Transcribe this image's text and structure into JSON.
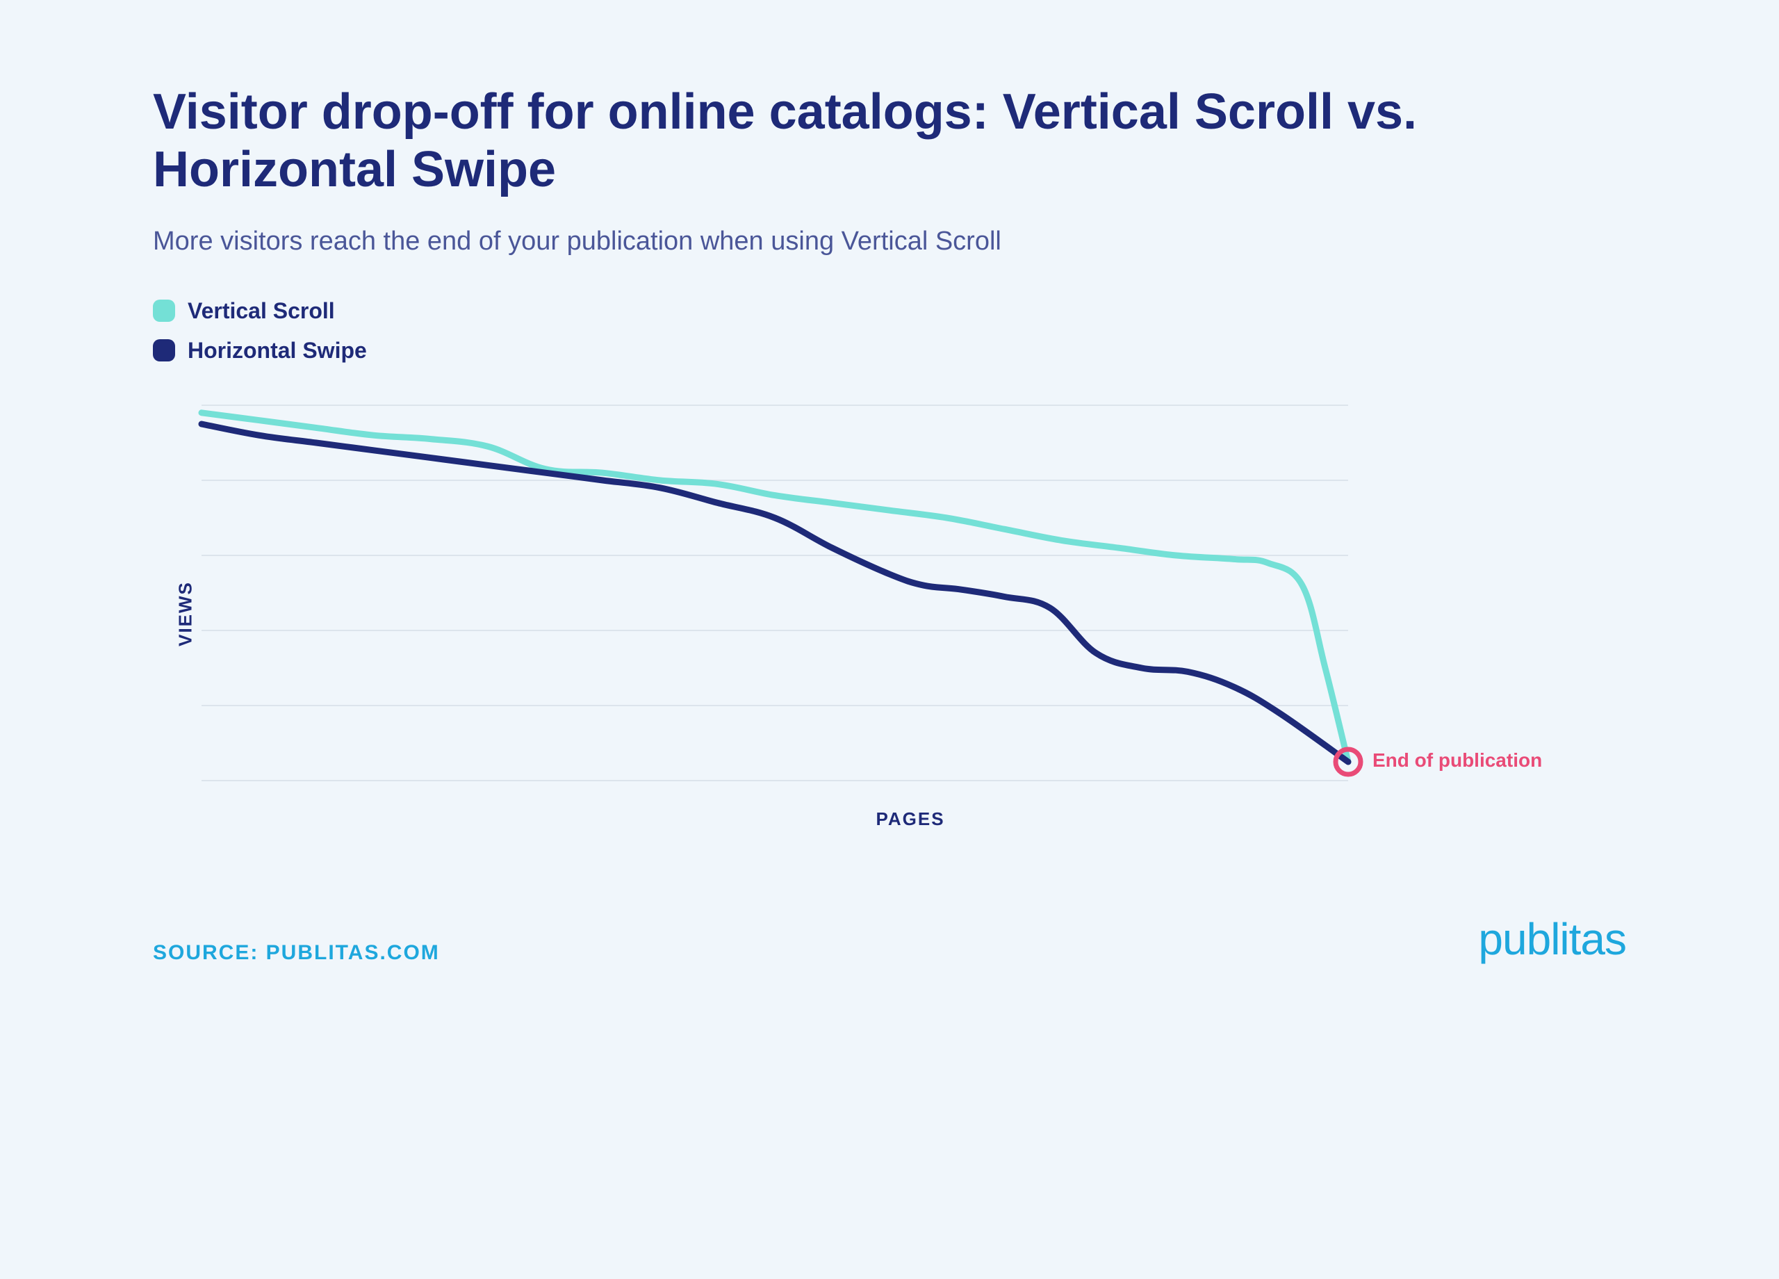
{
  "title": "Visitor drop-off for online catalogs: Vertical Scroll vs. Horizontal Swipe",
  "subtitle": "More visitors reach the end of your publication when using Vertical Scroll",
  "legend": {
    "series1": "Vertical Scroll",
    "series2": "Horizontal Swipe"
  },
  "axes": {
    "y": "VIEWS",
    "x": "PAGES"
  },
  "annotation": "End of publication",
  "source": "SOURCE: PUBLITAS.COM",
  "brand": "publitas",
  "colors": {
    "teal": "#74e0d6",
    "navy": "#1e2a78",
    "accent": "#e94b77",
    "grid": "#dce4ec"
  },
  "chart_data": {
    "type": "line",
    "xlabel": "PAGES",
    "ylabel": "VIEWS",
    "xlim": [
      0,
      100
    ],
    "ylim": [
      0,
      100
    ],
    "grid": true,
    "annotation": {
      "x": 100,
      "y": 5,
      "label": "End of publication"
    },
    "series": [
      {
        "name": "Vertical Scroll",
        "color": "#74e0d6",
        "x": [
          0,
          5,
          10,
          15,
          20,
          25,
          30,
          35,
          40,
          45,
          50,
          55,
          60,
          65,
          70,
          75,
          80,
          85,
          90,
          93,
          96,
          98,
          100
        ],
        "values": [
          98,
          96,
          94,
          92,
          91,
          89,
          83,
          82,
          80,
          79,
          76,
          74,
          72,
          70,
          67,
          64,
          62,
          60,
          59,
          58,
          52,
          30,
          5
        ]
      },
      {
        "name": "Horizontal Swipe",
        "color": "#1e2a78",
        "x": [
          0,
          5,
          10,
          15,
          20,
          25,
          30,
          35,
          40,
          45,
          50,
          55,
          60,
          63,
          66,
          70,
          74,
          78,
          82,
          86,
          90,
          94,
          100
        ],
        "values": [
          95,
          92,
          90,
          88,
          86,
          84,
          82,
          80,
          78,
          74,
          70,
          62,
          55,
          52,
          51,
          49,
          46,
          34,
          30,
          29,
          25,
          18,
          5
        ]
      }
    ]
  }
}
